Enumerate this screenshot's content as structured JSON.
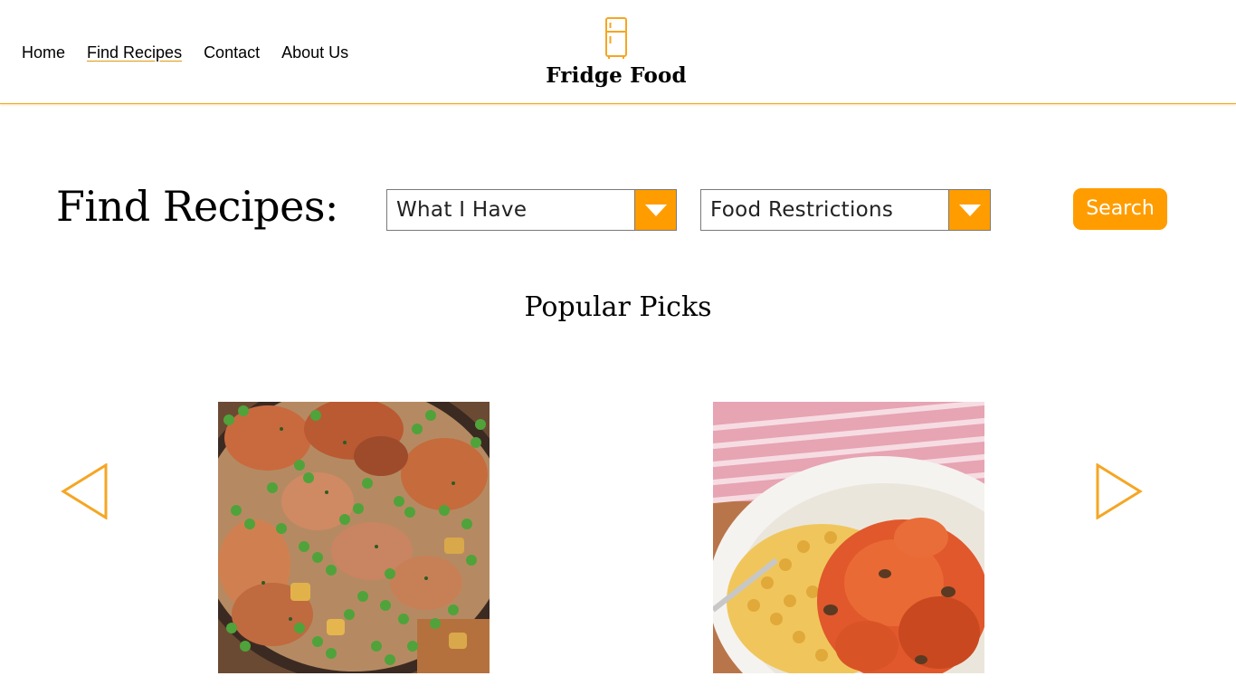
{
  "nav": {
    "items": [
      {
        "label": "Home",
        "active": false
      },
      {
        "label": "Find Recipes",
        "active": true
      },
      {
        "label": "Contact",
        "active": false
      },
      {
        "label": "About Us",
        "active": false
      }
    ]
  },
  "brand": {
    "name": "Fridge Food",
    "icon": "fridge-icon",
    "accent_color": "#ff9d00"
  },
  "finder": {
    "title": "Find Recipes:",
    "ingredients_select": {
      "value": "What I Have"
    },
    "restrictions_select": {
      "value": "Food Restrictions"
    },
    "search_label": "Search"
  },
  "popular": {
    "heading": "Popular Picks",
    "prev_icon": "triangle-left-icon",
    "next_icon": "triangle-right-icon",
    "cards": [
      {
        "image": "chicken-with-peas-skillet-photo"
      },
      {
        "image": "chicken-curry-with-pasta-photo"
      }
    ]
  }
}
